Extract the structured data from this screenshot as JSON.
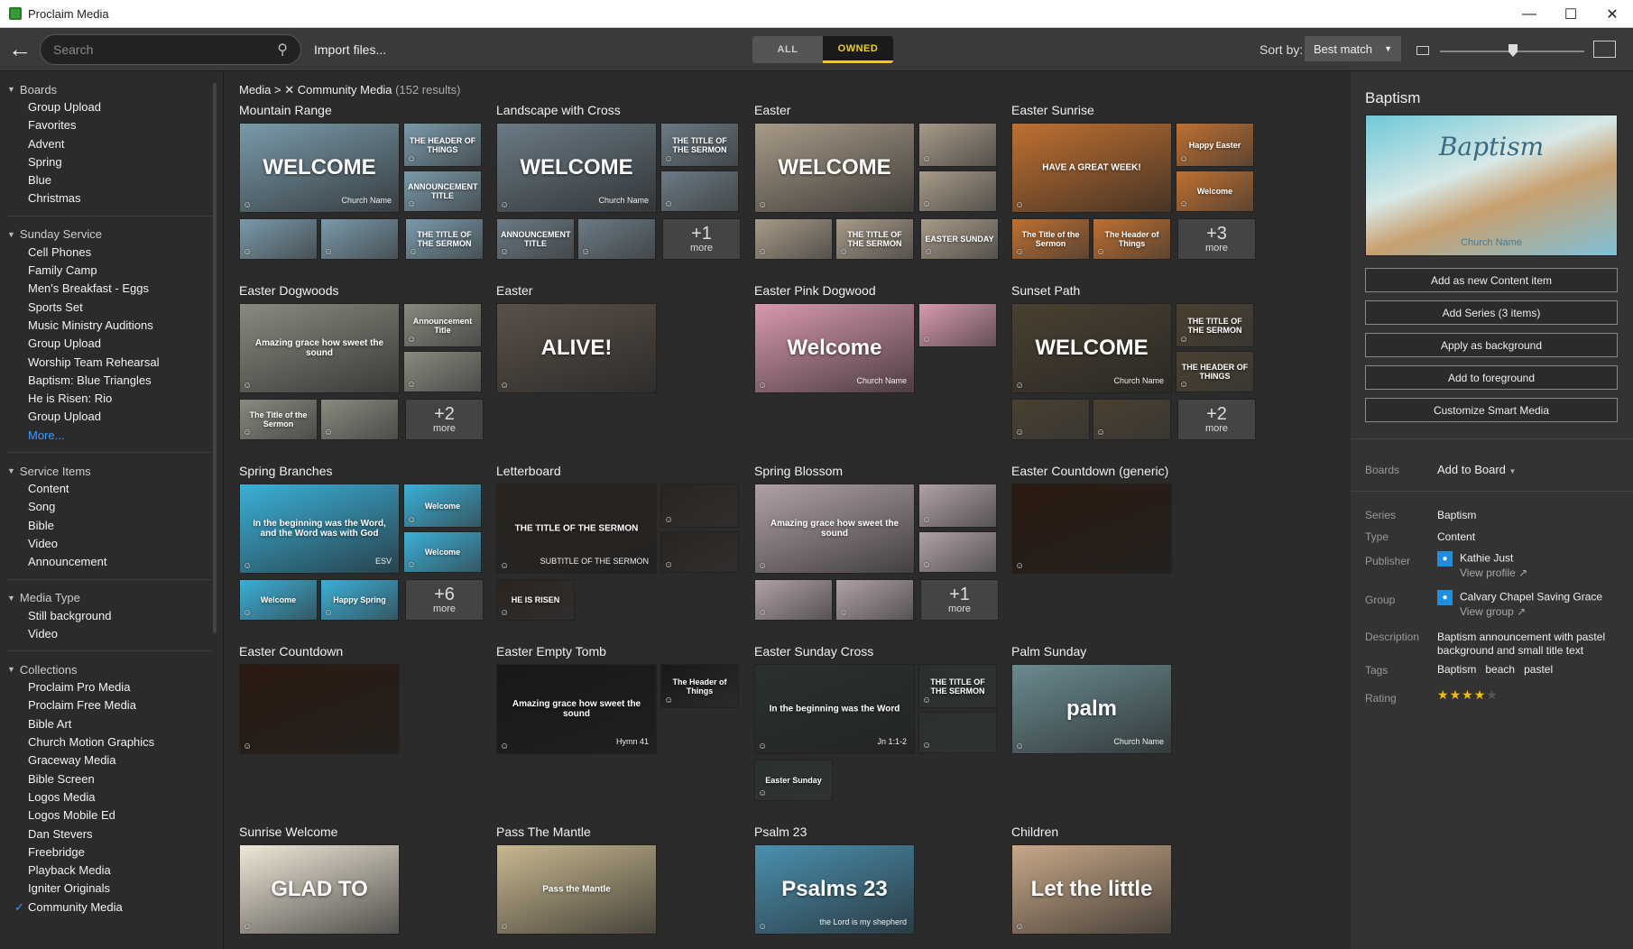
{
  "window": {
    "title": "Proclaim Media",
    "controls": [
      "—",
      "☐",
      "✕"
    ]
  },
  "toolbar": {
    "search_placeholder": "Search",
    "import_label": "Import files...",
    "filter_all": "ALL",
    "filter_owned": "OWNED",
    "sort_label": "Sort by:",
    "sort_value": "Best match",
    "zoom_level": 0.5
  },
  "sidebar": {
    "sections": [
      {
        "title": "Boards",
        "items": [
          "Group Upload",
          "Favorites",
          "Advent",
          "Spring",
          "Blue",
          "Christmas"
        ]
      },
      {
        "title": "Sunday Service",
        "items": [
          "Cell Phones",
          "Family Camp",
          "Men's Breakfast - Eggs",
          "Sports Set",
          "Music Ministry Auditions",
          "Group Upload",
          "Worship Team Rehearsal",
          "Baptism: Blue Triangles",
          "He is Risen: Rio",
          "Group Upload"
        ],
        "more": "More..."
      },
      {
        "title": "Service Items",
        "items": [
          "Content",
          "Song",
          "Bible",
          "Video",
          "Announcement"
        ]
      },
      {
        "title": "Media Type",
        "items": [
          "Still background",
          "Video"
        ]
      },
      {
        "title": "Collections",
        "items": [
          "Proclaim Pro Media",
          "Proclaim Free Media",
          "Bible Art",
          "Church Motion Graphics",
          "Graceway Media",
          "Bible Screen",
          "Logos Media",
          "Logos Mobile Ed",
          "Dan Stevers",
          "Freebridge",
          "Playback Media",
          "Igniter Originals",
          "Community Media"
        ]
      }
    ]
  },
  "breadcrumb": {
    "root": "Media",
    "filter": "Community Media",
    "count": "(152 results)"
  },
  "tiles": [
    {
      "title": "Mountain Range",
      "main": "WELCOME",
      "sub": "Church Name",
      "color": "#7a9aaa",
      "smalls": [
        "THE HEADER OF THINGS",
        "ANNOUNCEMENT TITLE",
        "",
        "",
        "THE TITLE OF THE SERMON"
      ]
    },
    {
      "title": "Landscape with Cross",
      "main": "WELCOME",
      "sub": "Church Name",
      "color": "#6a7a85",
      "smalls": [
        "THE TITLE OF THE SERMON",
        "",
        "ANNOUNCEMENT TITLE",
        ""
      ],
      "more": "+1"
    },
    {
      "title": "Easter",
      "main": "WELCOME",
      "sub": "",
      "color": "#a89a88",
      "smalls": [
        "",
        "",
        "",
        "THE TITLE OF THE SERMON",
        "EASTER SUNDAY"
      ]
    },
    {
      "title": "Easter Sunrise",
      "main": "HAVE A GREAT WEEK!",
      "sub": "",
      "color": "#c07030",
      "smalls": [
        "Happy Easter",
        "Welcome",
        "The Title of the Sermon",
        "The Header of Things"
      ],
      "more": "+3"
    },
    {
      "title": "Easter Dogwoods",
      "main": "Amazing grace how sweet the sound",
      "sub": "",
      "color": "#8a8a80",
      "smalls": [
        "Announcement Title",
        "",
        "The Title of the Sermon",
        ""
      ],
      "more": "+2"
    },
    {
      "title": "Easter",
      "main": "ALIVE!",
      "sub": "",
      "color": "#5a5048",
      "smalls": []
    },
    {
      "title": "Easter Pink Dogwood",
      "main": "Welcome",
      "sub": "Church Name",
      "color": "#d898b0",
      "smalls": [
        ""
      ]
    },
    {
      "title": "Sunset Path",
      "main": "WELCOME",
      "sub": "Church Name",
      "color": "#4a4030",
      "smalls": [
        "THE TITLE OF THE SERMON",
        "THE HEADER OF THINGS",
        "",
        ""
      ],
      "more": "+2"
    },
    {
      "title": "Spring Branches",
      "main": "In the beginning was the Word, and the Word was with God",
      "sub": "ESV",
      "color": "#3ab0d8",
      "smalls": [
        "Welcome",
        "Welcome",
        "Welcome",
        "Happy Spring"
      ],
      "more": "+6"
    },
    {
      "title": "Letterboard",
      "main": "THE TITLE OF THE SERMON",
      "sub": "SUBTITLE OF THE SERMON",
      "color": "#2a2420",
      "smalls": [
        "",
        "",
        "HE IS RISEN"
      ]
    },
    {
      "title": "Spring Blossom",
      "main": "Amazing grace how sweet the sound",
      "sub": "",
      "color": "#b0a0a8",
      "smalls": [
        "",
        "",
        "",
        ""
      ],
      "more": "+1"
    },
    {
      "title": "Easter Countdown (generic)",
      "main": "",
      "sub": "",
      "color": "#2a1a10",
      "smalls": []
    },
    {
      "title": "Easter Countdown",
      "main": "",
      "sub": "",
      "color": "#2a1a10",
      "smalls": []
    },
    {
      "title": "Easter Empty Tomb",
      "main": "Amazing grace how sweet the sound",
      "sub": "Hymn 41",
      "color": "#181818",
      "smalls": [
        "The Header of Things"
      ]
    },
    {
      "title": "Easter Sunday Cross",
      "main": "In the beginning was the Word",
      "sub": "Jn 1:1-2",
      "color": "#2a3030",
      "smalls": [
        "THE TITLE OF THE SERMON",
        "",
        "Easter Sunday"
      ]
    },
    {
      "title": "Palm Sunday",
      "main": "palm",
      "sub": "Church Name",
      "color": "#6a8a90",
      "smalls": []
    },
    {
      "title": "Sunrise Welcome",
      "main": "GLAD TO",
      "sub": "",
      "color": "#f0e8d8",
      "smalls": []
    },
    {
      "title": "Pass The Mantle",
      "main": "Pass the Mantle",
      "sub": "",
      "color": "#c8b890",
      "smalls": []
    },
    {
      "title": "Psalm 23",
      "main": "Psalms 23",
      "sub": "the Lord is my shepherd",
      "color": "#4a90b0",
      "smalls": []
    },
    {
      "title": "Children",
      "main": "Let the little",
      "sub": "",
      "color": "#c8a888",
      "smalls": []
    }
  ],
  "details": {
    "title": "Baptism",
    "preview_script": "Baptism",
    "preview_sub": "Church Name",
    "buttons": [
      "Add as new Content item",
      "Add Series (3 items)",
      "Apply as background",
      "Add to foreground",
      "Customize Smart Media"
    ],
    "boards_label": "Boards",
    "boards_action": "Add to Board",
    "series_label": "Series",
    "series_value": "Baptism",
    "type_label": "Type",
    "type_value": "Content",
    "publisher_label": "Publisher",
    "publisher_value": "Kathie Just",
    "publisher_link": "View profile",
    "group_label": "Group",
    "group_value": "Calvary Chapel Saving Grace",
    "group_link": "View group",
    "description_label": "Description",
    "description_value": "Baptism announcement with pastel background and small title text",
    "tags_label": "Tags",
    "tags": [
      "Baptism",
      "beach",
      "pastel"
    ],
    "rating_label": "Rating",
    "rating": 4,
    "rating_max": 5
  }
}
